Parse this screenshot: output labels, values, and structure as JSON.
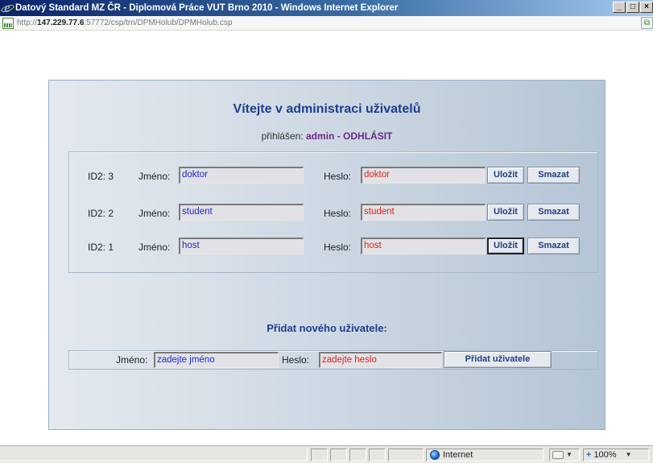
{
  "window": {
    "title": "Datový Standard MZ ČR - Diplomová Práce VUT Brno 2010 - Windows Internet Explorer",
    "buttons": {
      "minimize": "_",
      "maximize": "□",
      "close": "×"
    }
  },
  "address": {
    "url_prefix": "http://",
    "url_host": "147.229.77.6",
    "url_rest": ":57772/csp/trn/DPMHolub/DPMHolub.csp"
  },
  "page": {
    "heading": "Vítejte v administraci uživatelů",
    "logged_label": "přihlášen:",
    "logged_user": "admin",
    "separator": "-",
    "logout": "ODHLÁSIT",
    "users": [
      {
        "id_label": "ID2: 3",
        "name_label": "Jméno:",
        "name": "doktor",
        "pass_label": "Heslo:",
        "pass": "doktor",
        "save": "Uložit",
        "delete": "Smazat"
      },
      {
        "id_label": "ID2: 2",
        "name_label": "Jméno:",
        "name": "student",
        "pass_label": "Heslo:",
        "pass": "student",
        "save": "Uložit",
        "delete": "Smazat"
      },
      {
        "id_label": "ID2: 1",
        "name_label": "Jméno:",
        "name": "host",
        "pass_label": "Heslo:",
        "pass": "host",
        "save": "Uložit",
        "delete": "Smazat"
      }
    ],
    "add_heading": "Přidat nového uživatele:",
    "add": {
      "name_label": "Jméno:",
      "name_placeholder": "zadejte jméno",
      "pass_label": "Heslo:",
      "pass_placeholder": "zadejte heslo",
      "button": "Přidat uživatele"
    }
  },
  "status": {
    "zone": "Internet",
    "zoom": "100%",
    "zoom_plus": "+"
  },
  "colors": {
    "heading": "#1d3e8f",
    "name_text": "#1a2ad6",
    "pass_text": "#e0231d",
    "admin_link": "#6b2a86"
  }
}
